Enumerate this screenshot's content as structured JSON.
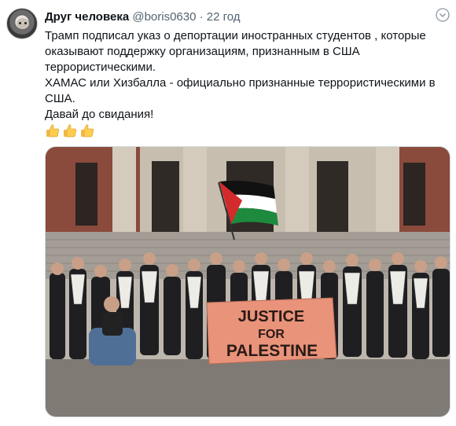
{
  "author": {
    "display_name": "Друг человека",
    "handle": "@boris0630",
    "separator": "·",
    "time": "22 год"
  },
  "tweet": {
    "lines": [
      "Трамп подписал указ о депортации иностранных студентов , которые оказывают поддержку организациям, признанным в США террористическими.",
      "ХАМАС или Хизбалла - официально признанные террористическими в США.",
      "Давай до свидания!"
    ],
    "emoji": [
      "thumbs-up",
      "thumbs-up",
      "thumbs-up"
    ]
  },
  "media": {
    "sign_text_1": "JUSTICE",
    "sign_text_2": "FOR",
    "sign_text_3": "PALESTINE"
  },
  "colors": {
    "sign": "#e8937a",
    "sign_text": "#2a1a16",
    "flag_black": "#111111",
    "flag_white": "#ffffff",
    "flag_green": "#1e8a3d",
    "flag_red": "#d32b2b",
    "brick": "#8a4a3c",
    "stone": "#c8beb0"
  }
}
